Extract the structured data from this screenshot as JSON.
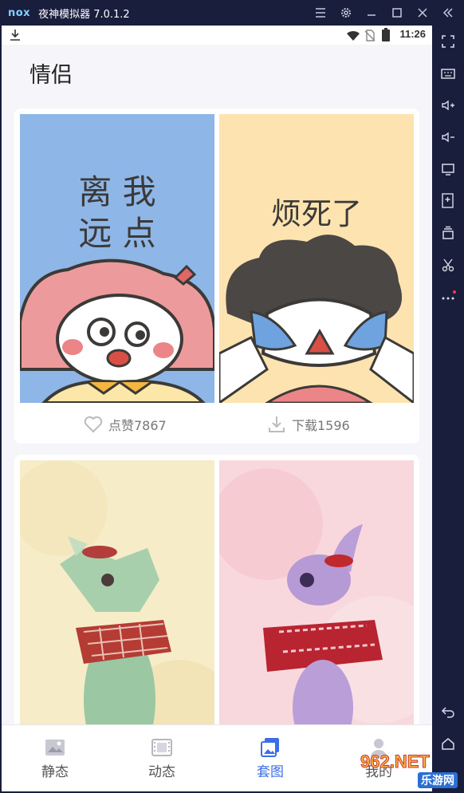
{
  "window": {
    "logo": "nox",
    "title": "夜神模拟器 7.0.1.2"
  },
  "status_bar": {
    "time": "11:26"
  },
  "page": {
    "title": "情侣"
  },
  "cards": [
    {
      "left_image_text": [
        "离 我",
        "远 点"
      ],
      "right_image_text": "烦死了",
      "like_label": "点赞7867",
      "download_label": "下载1596"
    }
  ],
  "bottom_nav": {
    "items": [
      {
        "label": "静态",
        "icon": "image-icon"
      },
      {
        "label": "动态",
        "icon": "film-icon"
      },
      {
        "label": "套图",
        "icon": "album-icon",
        "active": true
      },
      {
        "label": "我的",
        "icon": "user-icon"
      }
    ]
  },
  "watermark": {
    "text": "962.NET",
    "sub": "乐游网"
  },
  "colors": {
    "accent": "#3a6ee8",
    "emulator_frame": "#1a1e3d",
    "card1_left_bg": "#8eb6e6",
    "card1_right_bg": "#fde3b0"
  }
}
